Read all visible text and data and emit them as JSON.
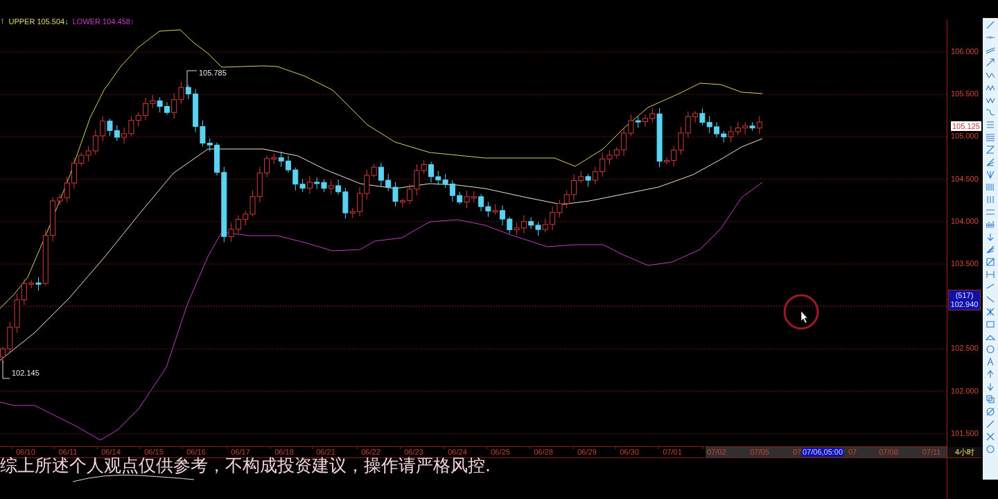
{
  "legend": [
    {
      "text": "↑"
    },
    {
      "text": "UPPER 105.504↓",
      "color": "#e0d870"
    },
    {
      "text": "LOWER 104.458↑",
      "color": "#c83cc8"
    }
  ],
  "chart_marks": {
    "high": "105.785",
    "low": "102.145"
  },
  "price_axis": {
    "ticks": [
      "106.000",
      "105.500",
      "105.000",
      "104.500",
      "104.000",
      "103.500",
      "102.500",
      "102.000",
      "101.500"
    ],
    "last_price": "105.125",
    "crosshair_count": "(517)",
    "crosshair_price": "102.940"
  },
  "time_axis": {
    "dates": [
      "06/10",
      "06/11",
      "06/14",
      "06/15",
      "06/16",
      "06/17",
      "06/18",
      "06/21",
      "06/22",
      "06/23",
      "06/24",
      "06/25",
      "06/28",
      "06/29",
      "06/30",
      "07/01",
      "07/02",
      "07/05",
      "07",
      "07",
      "07/08",
      "07/11"
    ],
    "crosshair_time": "07/06,05:00",
    "period": "4小时"
  },
  "subtitle": "综上所述个人观点仅供参考，不构成投资建议，操作请严格风控."
}
